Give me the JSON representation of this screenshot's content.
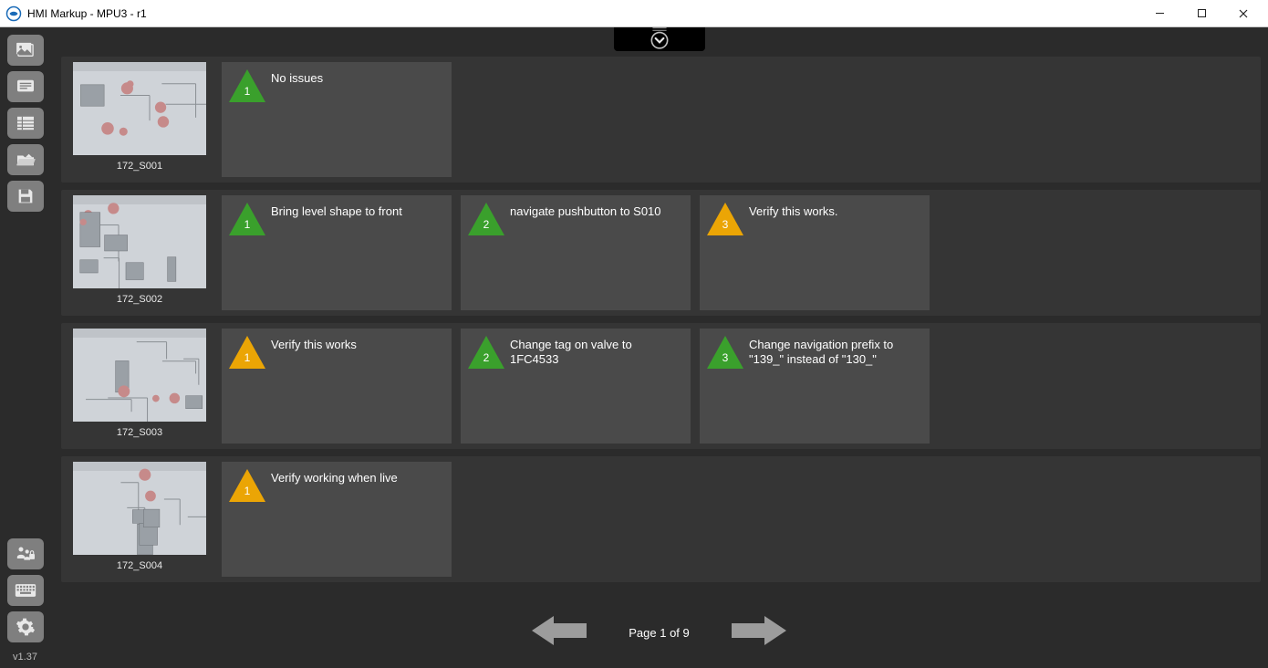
{
  "window": {
    "title": "HMI Markup - MPU3 - r1"
  },
  "sidebar": {
    "top_icons": [
      "pictures-icon",
      "notes-icon",
      "table-icon",
      "folder-open-icon",
      "save-icon"
    ],
    "bottom_icons": [
      "user-lock-icon",
      "keyboard-icon",
      "settings-icon"
    ],
    "version": "v1.37"
  },
  "colors": {
    "green": "#3aa02c",
    "amber": "#eba505",
    "row_bg": "#353535",
    "note_bg": "#4a4a4a"
  },
  "pull_tab_icon": "chevron-down-icon",
  "screens": [
    {
      "name": "172_S001",
      "notes": [
        {
          "n": "1",
          "color": "green",
          "text": "No issues"
        }
      ]
    },
    {
      "name": "172_S002",
      "notes": [
        {
          "n": "1",
          "color": "green",
          "text": "Bring level shape to front"
        },
        {
          "n": "2",
          "color": "green",
          "text": "navigate pushbutton to S010"
        },
        {
          "n": "3",
          "color": "amber",
          "text": "Verify this works."
        }
      ]
    },
    {
      "name": "172_S003",
      "notes": [
        {
          "n": "1",
          "color": "amber",
          "text": "Verify this works"
        },
        {
          "n": "2",
          "color": "green",
          "text": "Change tag on valve to 1FC4533"
        },
        {
          "n": "3",
          "color": "green",
          "text": "Change navigation prefix to \"139_\" instead of \"130_\""
        }
      ]
    },
    {
      "name": "172_S004",
      "notes": [
        {
          "n": "1",
          "color": "amber",
          "text": "Verify working when live"
        }
      ]
    }
  ],
  "pager": {
    "text": "Page 1 of 9"
  }
}
